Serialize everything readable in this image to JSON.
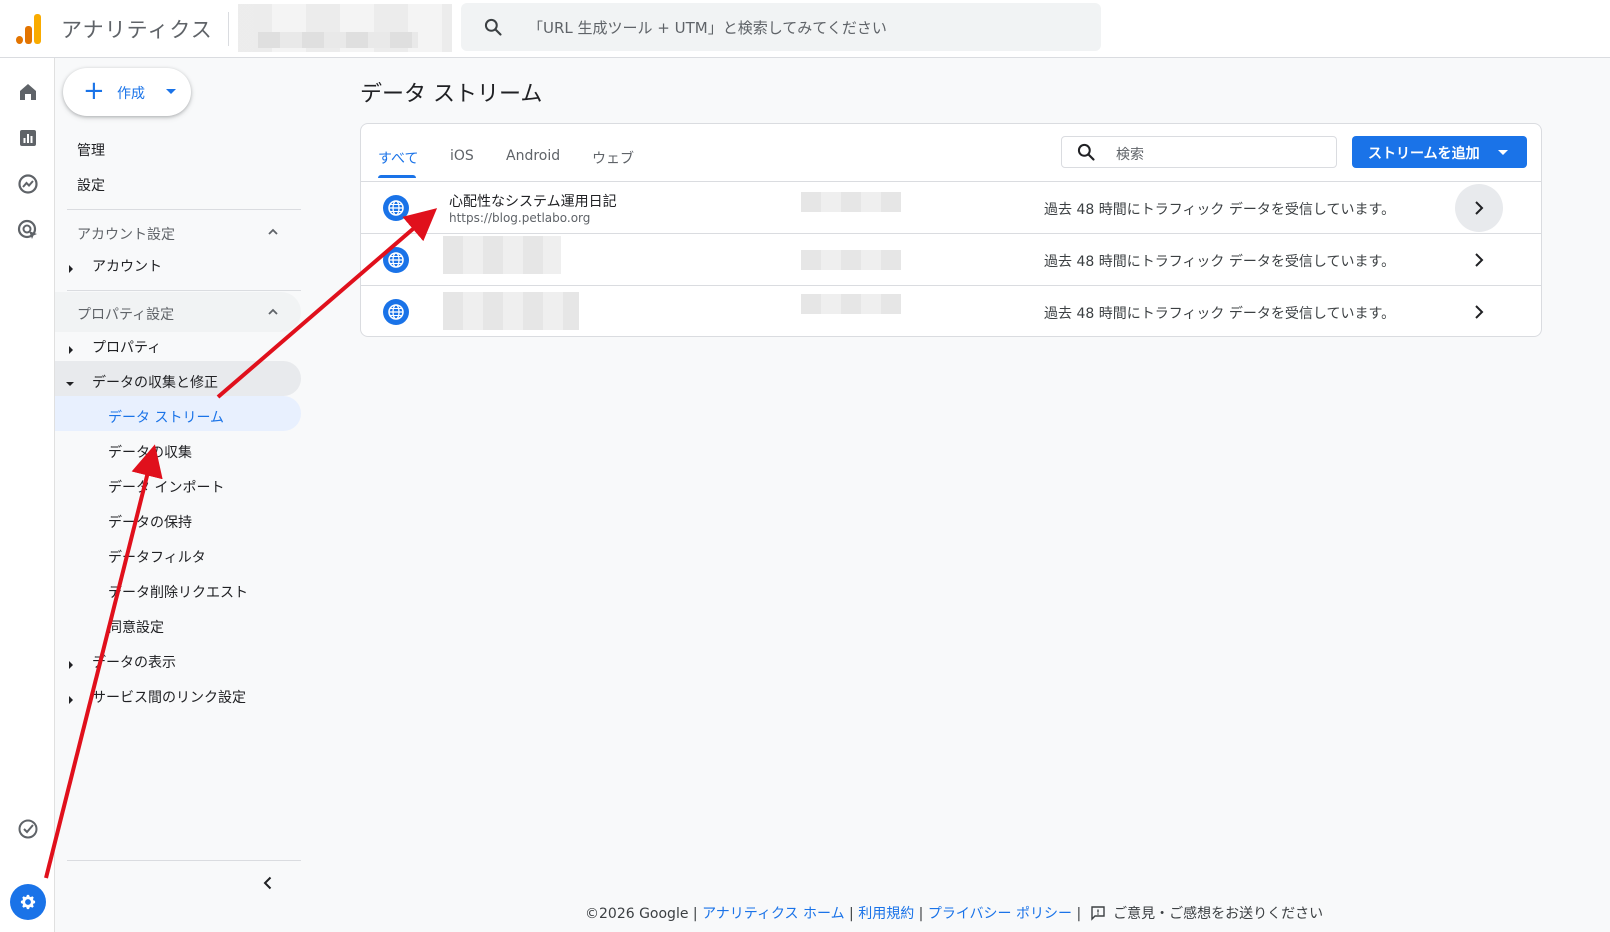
{
  "header": {
    "app_title": "アナリティクス",
    "search_placeholder": "「URL 生成ツール + UTM」と検索してみてください"
  },
  "rail": {
    "icons": [
      "home-icon",
      "reports-icon",
      "explore-icon",
      "advertising-icon",
      "insights-check-icon",
      "admin-gear-icon"
    ]
  },
  "nav": {
    "create_label": "作成",
    "admin_label": "管理",
    "settings_label": "設定",
    "account_section": "アカウント設定",
    "account_item": "アカウント",
    "property_section": "プロパティ設定",
    "property_item": "プロパティ",
    "data_collection_group": "データの収集と修正",
    "sub_items": [
      "データ ストリーム",
      "データの収集",
      "データ インポート",
      "データの保持",
      "データフィルタ",
      "データ削除リクエスト",
      "同意設定"
    ],
    "data_display": "データの表示",
    "service_links": "サービス間のリンク設定"
  },
  "main": {
    "page_title": "データ ストリーム",
    "tabs": [
      "すべて",
      "iOS",
      "Android",
      "ウェブ"
    ],
    "search_placeholder": "検索",
    "add_stream_label": "ストリームを追加",
    "streams": [
      {
        "name": "心配性なシステム運用日記",
        "url": "https://blog.petlabo.org",
        "status": "過去 48 時間にトラフィック データを受信しています。"
      },
      {
        "name": "",
        "url": "",
        "status": "過去 48 時間にトラフィック データを受信しています。"
      },
      {
        "name": "",
        "url": "",
        "status": "過去 48 時間にトラフィック データを受信しています。"
      }
    ]
  },
  "footer": {
    "copyright": "©2026 Google |",
    "home_link": "アナリティクス ホーム",
    "terms_link": "利用規約",
    "privacy_link": "プライバシー ポリシー",
    "feedback": "ご意見・ご感想をお送りください",
    "sep": "|"
  },
  "colors": {
    "accent": "#1a73e8",
    "annotation_arrow": "#e0101c",
    "logo_orange": "#e37400",
    "logo_yellow": "#f9ab00"
  }
}
